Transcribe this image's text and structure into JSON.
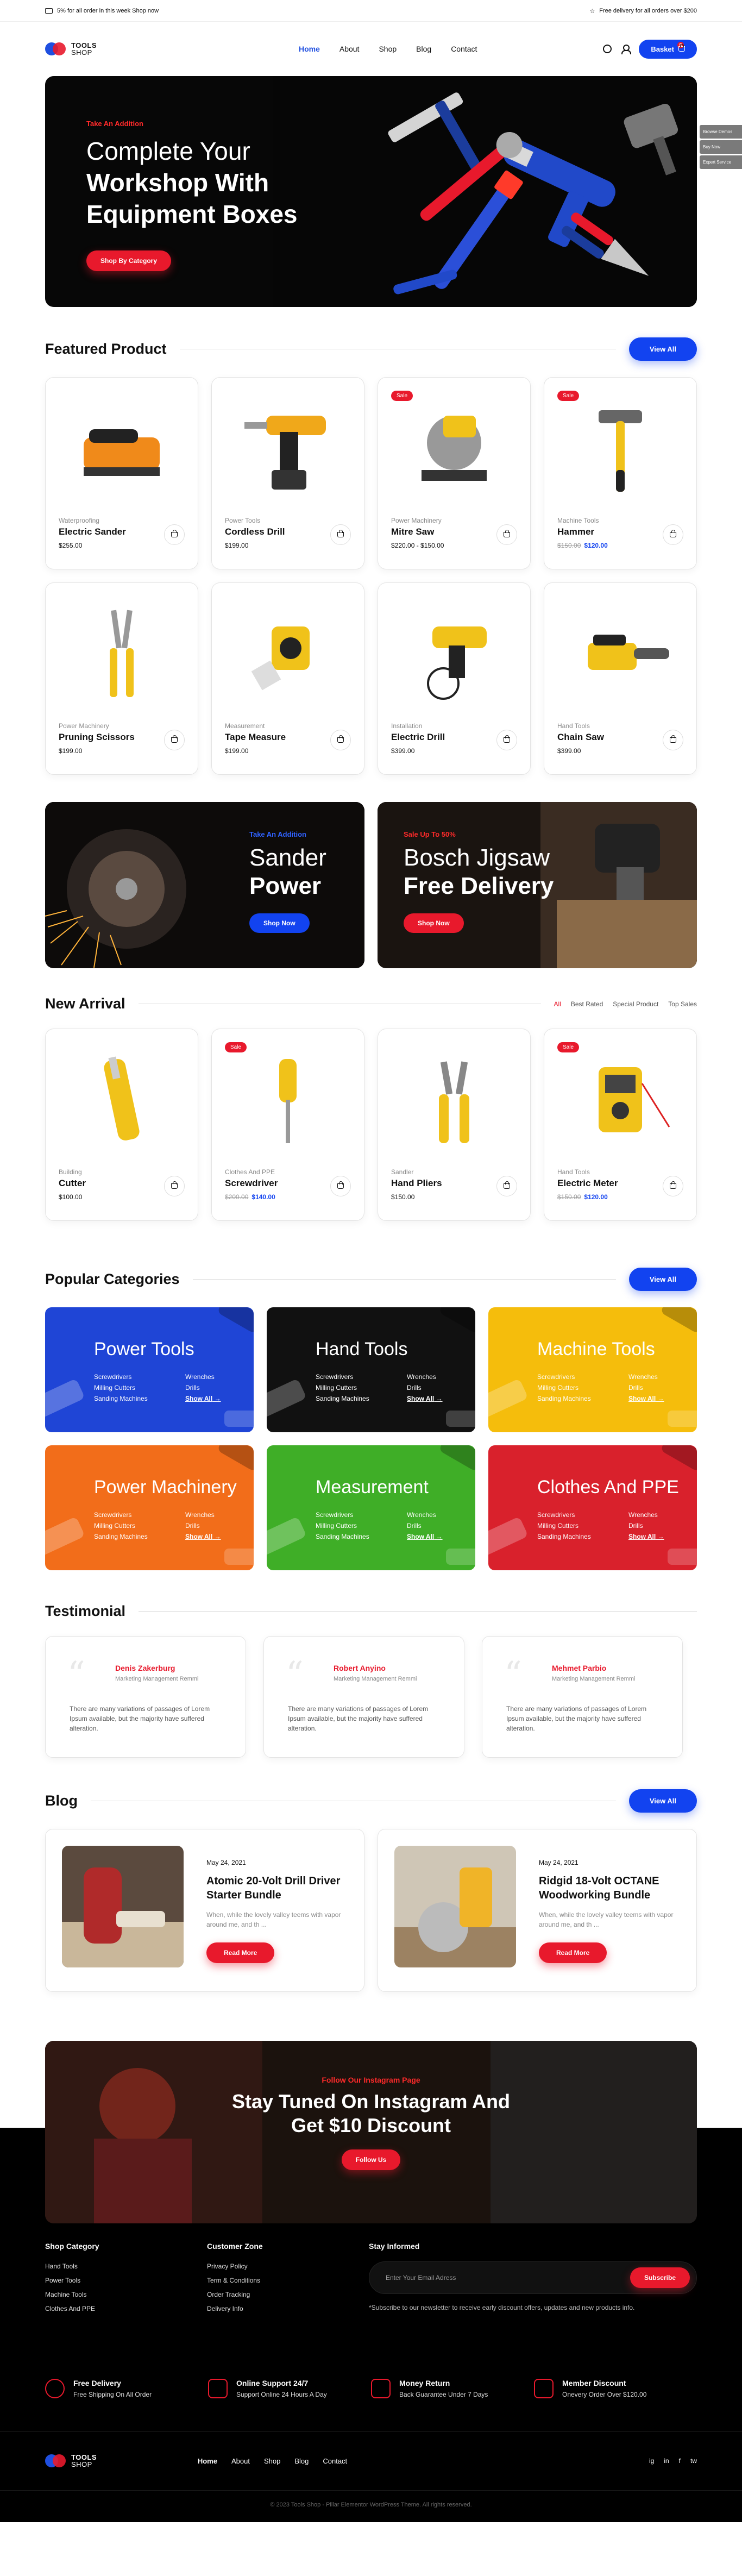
{
  "topbar": {
    "left": "5% for all order in this week Shop now",
    "right": "Free delivery for all orders over $200"
  },
  "brand": {
    "name_line1": "TOOLS",
    "name_line2": "SHOP"
  },
  "nav": {
    "items": [
      "Home",
      "About",
      "Shop",
      "Blog",
      "Contact"
    ]
  },
  "header": {
    "basket": "Basket",
    "basket_count": "0"
  },
  "hero": {
    "kicker": "Take An Addition",
    "line1": "Complete Your",
    "line2": "Workshop With",
    "line3": "Equipment Boxes",
    "cta": "Shop By Category"
  },
  "side_tabs": [
    "Browse Demos",
    "Buy Now",
    "Expert Service"
  ],
  "featured": {
    "title": "Featured Product",
    "button": "View All",
    "products": [
      {
        "category": "Waterproofing",
        "name": "Electric Sander",
        "price": "$255.00",
        "old": "",
        "new": "",
        "sale": ""
      },
      {
        "category": "Power Tools",
        "name": "Cordless Drill",
        "price": "$199.00",
        "old": "",
        "new": "",
        "sale": ""
      },
      {
        "category": "Power Machinery",
        "name": "Mitre Saw",
        "price": "$220.00 - $150.00",
        "old": "",
        "new": "",
        "sale": "Sale"
      },
      {
        "category": "Machine Tools",
        "name": "Hammer",
        "price": "",
        "old": "$150.00",
        "new": "$120.00",
        "sale": "Sale"
      },
      {
        "category": "Power Machinery",
        "name": "Pruning Scissors",
        "price": "$199.00",
        "old": "",
        "new": "",
        "sale": ""
      },
      {
        "category": "Measurement",
        "name": "Tape Measure",
        "price": "$199.00",
        "old": "",
        "new": "",
        "sale": ""
      },
      {
        "category": "Installation",
        "name": "Electric Drill",
        "price": "$399.00",
        "old": "",
        "new": "",
        "sale": ""
      },
      {
        "category": "Hand Tools",
        "name": "Chain Saw",
        "price": "$399.00",
        "old": "",
        "new": "",
        "sale": ""
      }
    ]
  },
  "promos": [
    {
      "kicker": "Take An Addition",
      "t1": "Sander",
      "t2": "Power",
      "cta": "Shop Now"
    },
    {
      "kicker": "Sale Up To 50%",
      "t1": "Bosch Jigsaw",
      "t2": "Free Delivery",
      "cta": "Shop Now"
    }
  ],
  "arrivals": {
    "title": "New Arrival",
    "filters": [
      "All",
      "Best Rated",
      "Special Product",
      "Top Sales"
    ],
    "products": [
      {
        "category": "Building",
        "name": "Cutter",
        "price": "$100.00",
        "old": "",
        "new": "",
        "sale": ""
      },
      {
        "category": "Clothes And PPE",
        "name": "Screwdriver",
        "price": "",
        "old": "$200.00",
        "new": "$140.00",
        "sale": "Sale"
      },
      {
        "category": "Sandler",
        "name": "Hand Pliers",
        "price": "$150.00",
        "old": "",
        "new": "",
        "sale": ""
      },
      {
        "category": "Hand Tools",
        "name": "Electric Meter",
        "price": "",
        "old": "$150.00",
        "new": "$120.00",
        "sale": "Sale"
      }
    ]
  },
  "categories": {
    "title": "Popular Categories",
    "button": "View All",
    "items": [
      {
        "name": "Power Tools",
        "color": "#1f45d6",
        "l": [
          "Screwdrivers",
          "Milling Cutters",
          "Sanding Machines"
        ],
        "r": [
          "Wrenches",
          "Drills",
          "Show All"
        ]
      },
      {
        "name": "Hand Tools",
        "color": "#111111",
        "l": [
          "Screwdrivers",
          "Milling Cutters",
          "Sanding Machines"
        ],
        "r": [
          "Wrenches",
          "Drills",
          "Show All"
        ]
      },
      {
        "name": "Machine Tools",
        "color": "#f5bd0c",
        "l": [
          "Screwdrivers",
          "Milling Cutters",
          "Sanding Machines"
        ],
        "r": [
          "Wrenches",
          "Drills",
          "Show All"
        ]
      },
      {
        "name": "Power Machinery",
        "color": "#f26d1a",
        "l": [
          "Screwdrivers",
          "Milling Cutters",
          "Sanding Machines"
        ],
        "r": [
          "Wrenches",
          "Drills",
          "Show All"
        ]
      },
      {
        "name": "Measurement",
        "color": "#3fae27",
        "l": [
          "Screwdrivers",
          "Milling Cutters",
          "Sanding Machines"
        ],
        "r": [
          "Wrenches",
          "Drills",
          "Show All"
        ]
      },
      {
        "name": "Clothes And PPE",
        "color": "#d9212c",
        "l": [
          "Screwdrivers",
          "Milling Cutters",
          "Sanding Machines"
        ],
        "r": [
          "Wrenches",
          "Drills",
          "Show All"
        ]
      }
    ]
  },
  "testimonial": {
    "title": "Testimonial",
    "items": [
      {
        "name": "Denis Zakerburg",
        "role": "Marketing Management Remmi",
        "body": "There are many variations of passages of Lorem Ipsum available, but the majority have suffered alteration."
      },
      {
        "name": "Robert Anyino",
        "role": "Marketing Management Remmi",
        "body": "There are many variations of passages of Lorem Ipsum available, but the majority have suffered alteration."
      },
      {
        "name": "Mehmet Parbio",
        "role": "Marketing Management Remmi",
        "body": "There are many variations of passages of Lorem Ipsum available, but the majority have suffered alteration."
      }
    ]
  },
  "blog": {
    "title": "Blog",
    "button": "View All",
    "posts": [
      {
        "date": "May 24, 2021",
        "title": "Atomic 20-Volt Drill Driver Starter Bundle",
        "excerpt": "When, while the lovely valley teems with vapor around me, and th ...",
        "cta": "Read More"
      },
      {
        "date": "May 24, 2021",
        "title": "Ridgid 18-Volt OCTANE Woodworking Bundle",
        "excerpt": "When, while the lovely valley teems with vapor around me, and th ...",
        "cta": "Read More"
      }
    ]
  },
  "instagram": {
    "kicker": "Follow Our Instagram Page",
    "line1": "Stay Tuned On Instagram And",
    "line2": "Get $10 Discount",
    "cta": "Follow Us"
  },
  "footer": {
    "col1": {
      "title": "Shop Category",
      "items": [
        "Hand Tools",
        "Power Tools",
        "Machine Tools",
        "Clothes And PPE"
      ]
    },
    "col2": {
      "title": "Customer Zone",
      "items": [
        "Privacy Policy",
        "Term & Conditions",
        "Order Tracking",
        "Delivery Info"
      ]
    },
    "stay": {
      "title": "Stay Informed",
      "placeholder": "Enter Your Email Adress",
      "button": "Subscribe",
      "note": "*Subscribe to our newsletter to receive early discount offers, updates and new products info."
    },
    "features": [
      {
        "title": "Free Delivery",
        "sub": "Free Shipping On All Order"
      },
      {
        "title": "Online Support 24/7",
        "sub": "Support Online 24 Hours A Day"
      },
      {
        "title": "Money Return",
        "sub": "Back Guarantee Under 7 Days"
      },
      {
        "title": "Member Discount",
        "sub": "Onevery Order Over $120.00"
      }
    ],
    "nav": [
      "Home",
      "About",
      "Shop",
      "Blog",
      "Contact"
    ],
    "social": [
      "ig",
      "in",
      "f",
      "tw"
    ],
    "copyright": "© 2023 Tools Shop - Pillar Elementor WordPress Theme. All rights reserved."
  }
}
